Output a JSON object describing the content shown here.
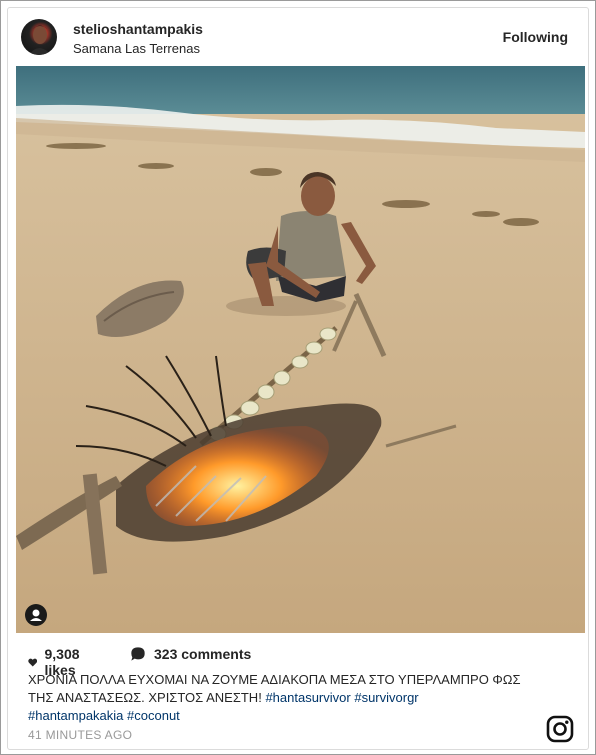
{
  "post": {
    "username": "stelioshantampakis",
    "location": "Samana Las Terrenas",
    "follow_label": "Following",
    "likes": "9,308 likes",
    "comments": "323 comments",
    "caption_text": "ΧΡΟΝΙΑ ΠΟΛΛΑ ΕΥΧΟΜΑΙ ΝΑ ΖΟΥΜΕ ΑΔΙΑΚΟΠΑ ΜΕΣΑ ΣΤΟ ΥΠΕΡΛΑΜΠΡΟ ΦΩΣ ΤΗΣ ΑΝΑΣΤΑΣΕΩΣ. ΧΡΙΣΤΟΣ ΑΝΕΣΤΗ!",
    "hashtags": [
      "#hantasurvivor",
      "#survivorgr",
      "#hantampakakia",
      "#coconut"
    ],
    "timestamp": "41 MINUTES AGO"
  },
  "icons": {
    "like": "heart-icon",
    "comment": "comment-bubble-icon",
    "tagged": "user-tag-icon",
    "brand": "instagram-icon"
  }
}
